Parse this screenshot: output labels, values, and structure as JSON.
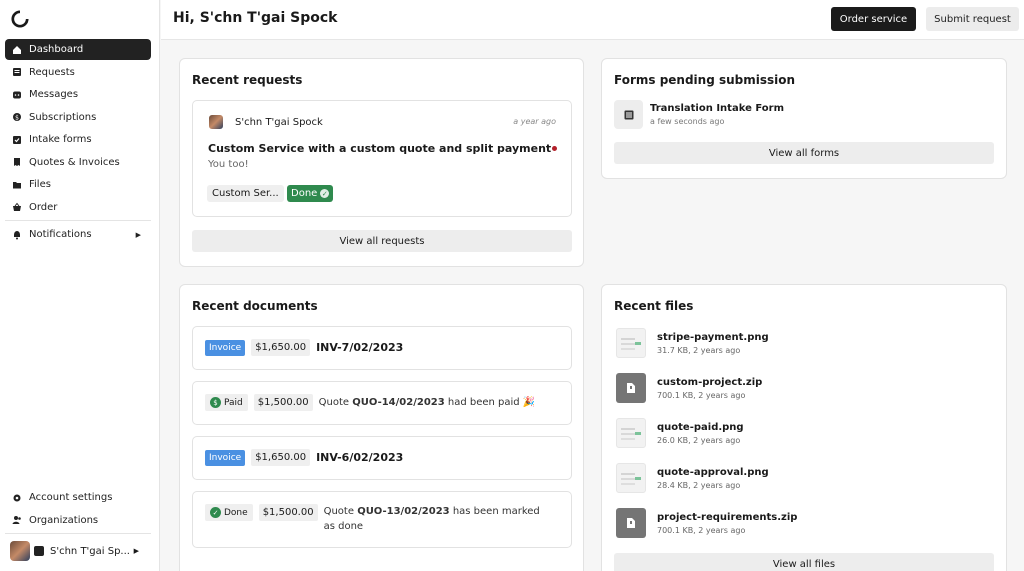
{
  "header": {
    "greeting": "Hi, S'chn T'gai Spock",
    "order_label": "Order service",
    "submit_label": "Submit request"
  },
  "sidebar": {
    "items": [
      {
        "label": "Dashboard",
        "icon": "home-icon",
        "active": true
      },
      {
        "label": "Requests",
        "icon": "inbox-icon"
      },
      {
        "label": "Messages",
        "icon": "chat-icon"
      },
      {
        "label": "Subscriptions",
        "icon": "dollar-icon"
      },
      {
        "label": "Intake forms",
        "icon": "check-square-icon"
      },
      {
        "label": "Quotes & Invoices",
        "icon": "receipt-icon"
      },
      {
        "label": "Files",
        "icon": "folder-icon"
      },
      {
        "label": "Order",
        "icon": "basket-icon"
      }
    ],
    "notifications_label": "Notifications",
    "account_label": "Account settings",
    "orgs_label": "Organizations",
    "profile_name": "S'chn T'gai Sp..."
  },
  "recent_requests": {
    "title": "Recent requests",
    "item": {
      "user": "S'chn T'gai Spock",
      "time": "a year ago",
      "title": "Custom Service with a custom quote and split payment",
      "message": "You too!",
      "service_tag": "Custom Ser...",
      "status": "Done"
    },
    "view_all": "View all requests"
  },
  "forms_pending": {
    "title": "Forms pending submission",
    "form_name": "Translation Intake Form",
    "form_time": "a few seconds ago",
    "view_all": "View all forms"
  },
  "recent_documents": {
    "title": "Recent documents",
    "items": [
      {
        "badge": "Invoice",
        "amount": "$1,650.00",
        "number": "INV-7/02/2023"
      },
      {
        "badge": "Paid",
        "amount": "$1,500.00",
        "prefix": "Quote",
        "number": "QUO-14/02/2023",
        "suffix": "had been paid 🎉"
      },
      {
        "badge": "Invoice",
        "amount": "$1,650.00",
        "number": "INV-6/02/2023"
      },
      {
        "badge": "Done",
        "amount": "$1,500.00",
        "prefix": "Quote",
        "number": "QUO-13/02/2023",
        "suffix": "has been marked as",
        "suffix2": "done"
      }
    ]
  },
  "recent_files": {
    "title": "Recent files",
    "items": [
      {
        "name": "stripe-payment.png",
        "meta": "31.7 KB, 2 years ago",
        "kind": "png"
      },
      {
        "name": "custom-project.zip",
        "meta": "700.1 KB, 2 years ago",
        "kind": "zip"
      },
      {
        "name": "quote-paid.png",
        "meta": "26.0 KB, 2 years ago",
        "kind": "png"
      },
      {
        "name": "quote-approval.png",
        "meta": "28.4 KB, 2 years ago",
        "kind": "png"
      },
      {
        "name": "project-requirements.zip",
        "meta": "700.1 KB, 2 years ago",
        "kind": "zip"
      }
    ],
    "view_all": "View all files"
  },
  "colors": {
    "accent": "#1b1b1b",
    "done_green": "#2f8a4e",
    "invoice_blue": "#4a90e2",
    "unread_red": "#b3202a"
  }
}
